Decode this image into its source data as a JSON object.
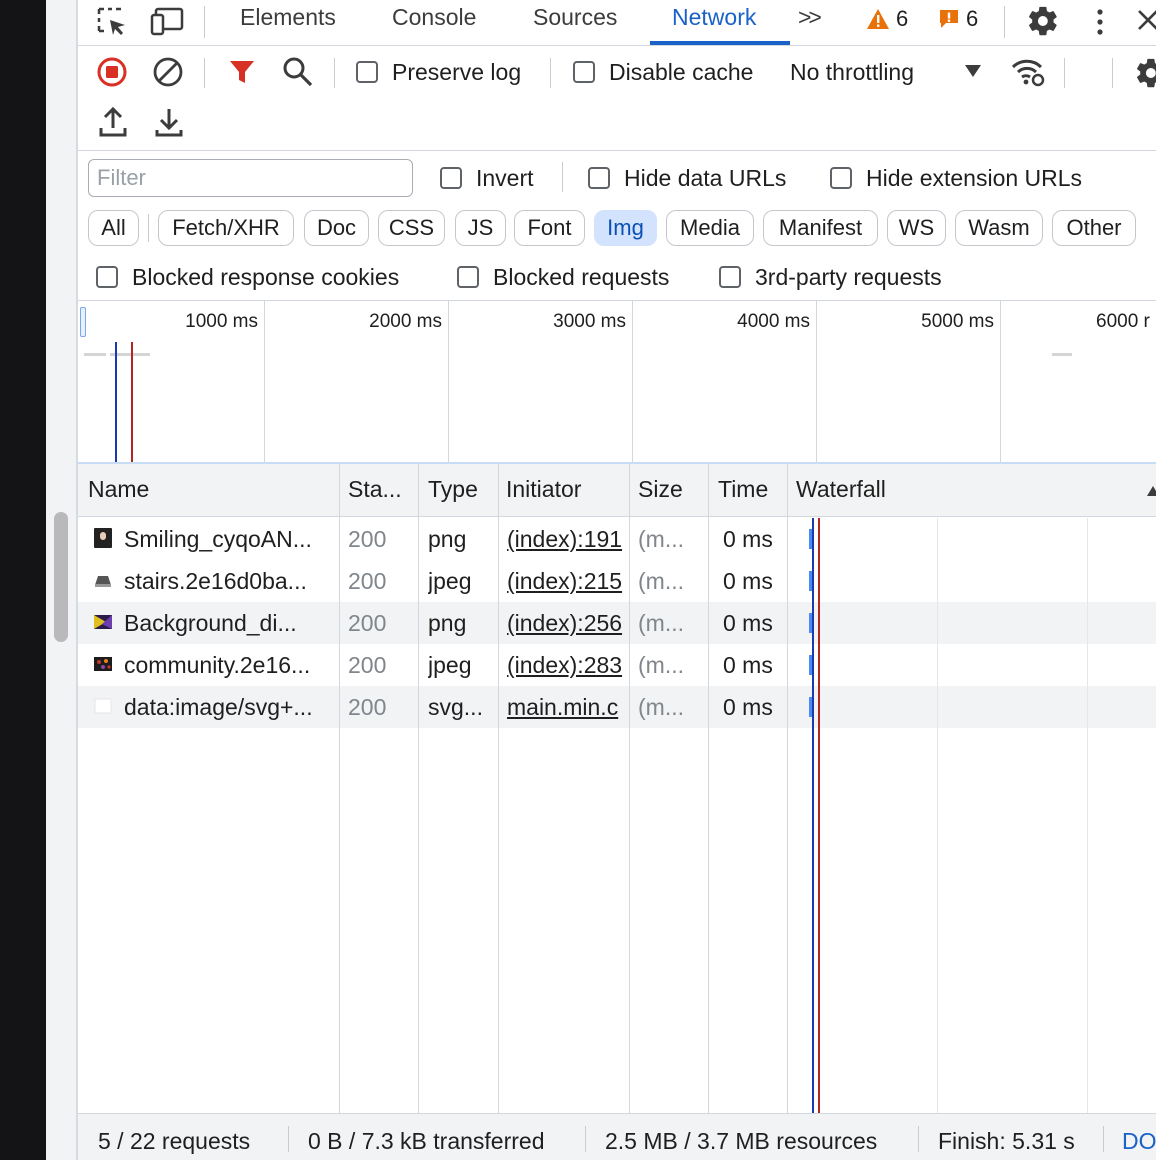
{
  "tabs": {
    "elements": "Elements",
    "console": "Console",
    "sources": "Sources",
    "network": "Network",
    "more": ">>",
    "warnings_count": "6",
    "errors_count": "6"
  },
  "toolbar": {
    "preserve_log": "Preserve log",
    "disable_cache": "Disable cache",
    "throttling": "No throttling"
  },
  "filter": {
    "placeholder": "Filter",
    "invert": "Invert",
    "hide_data_urls": "Hide data URLs",
    "hide_extension_urls": "Hide extension URLs",
    "types": [
      "All",
      "Fetch/XHR",
      "Doc",
      "CSS",
      "JS",
      "Font",
      "Img",
      "Media",
      "Manifest",
      "WS",
      "Wasm",
      "Other"
    ],
    "selected_type": "Img",
    "blocked_response_cookies": "Blocked response cookies",
    "blocked_requests": "Blocked requests",
    "third_party_requests": "3rd-party requests"
  },
  "overview": {
    "ticks": [
      "1000 ms",
      "2000 ms",
      "3000 ms",
      "4000 ms",
      "5000 ms",
      "6000 r"
    ]
  },
  "table": {
    "headers": {
      "name": "Name",
      "status": "Sta...",
      "type": "Type",
      "initiator": "Initiator",
      "size": "Size",
      "time": "Time",
      "waterfall": "Waterfall"
    },
    "rows": [
      {
        "name": "Smiling_cyqoAN...",
        "status": "200",
        "type": "png",
        "initiator": "(index):191",
        "size": "(m...",
        "time": "0 ms"
      },
      {
        "name": "stairs.2e16d0ba...",
        "status": "200",
        "type": "jpeg",
        "initiator": "(index):215",
        "size": "(m...",
        "time": "0 ms"
      },
      {
        "name": "Background_di...",
        "status": "200",
        "type": "png",
        "initiator": "(index):256",
        "size": "(m...",
        "time": "0 ms"
      },
      {
        "name": "community.2e16...",
        "status": "200",
        "type": "jpeg",
        "initiator": "(index):283",
        "size": "(m...",
        "time": "0 ms"
      },
      {
        "name": "data:image/svg+...",
        "status": "200",
        "type": "svg...",
        "initiator": "main.min.c",
        "size": "(m...",
        "time": "0 ms"
      }
    ]
  },
  "footer": {
    "requests": "5 / 22 requests",
    "transferred": "0 B / 7.3 kB transferred",
    "resources": "2.5 MB / 3.7 MB resources",
    "finish": "Finish: 5.31 s",
    "dom": "DO"
  },
  "colors": {
    "accent": "#1a62c8",
    "record_red": "#d93025",
    "warning_orange": "#e8710a",
    "dcl_line_blue": "#1a3bb0",
    "load_line_red": "#b3261e"
  }
}
